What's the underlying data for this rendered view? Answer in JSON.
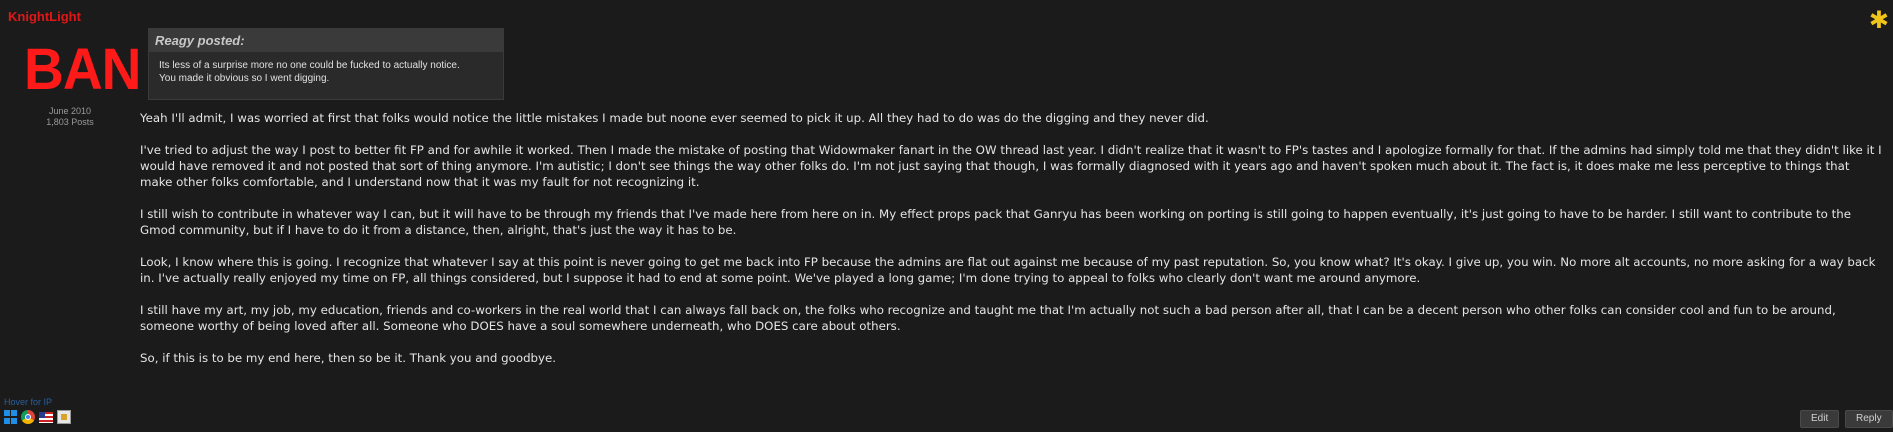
{
  "user": {
    "name": "KnightLight",
    "ban_text": "BAN",
    "join_date": "June 2010",
    "post_count": "1,803 Posts"
  },
  "quote": {
    "header": "Reagy posted:",
    "line1": "Its less of a surprise more no one could be fucked to actually notice.",
    "line2": "You made it obvious so I went digging."
  },
  "post": {
    "paragraphs": [
      "Yeah I'll admit, I was worried at first that folks would notice the little mistakes I made but noone ever seemed to pick it up. All they had to do was do the digging and they never did.",
      "I've tried to adjust the way I post to better fit FP and for awhile it worked. Then I made the mistake of posting that Widowmaker fanart in the OW thread last year. I didn't realize that it wasn't to FP's tastes and I apologize formally for that. If the admins had simply told me that they didn't like it I would have removed it and not posted that sort of thing anymore. I'm autistic; I don't see things the way other folks do. I'm not just saying that though, I was formally diagnosed with it years ago and haven't spoken much about it. The fact is, it does make me less perceptive to things that make other folks comfortable, and I understand now that it was my fault for not recognizing it.",
      "I still wish to contribute in whatever way I can, but it will have to be through my friends that I've made here from here on in. My effect props pack that Ganryu has been working on porting is still going to happen eventually, it's just going to have to be harder. I still want to contribute to the Gmod community, but if I have to do it from a distance, then, alright, that's just the way it has to be.",
      "Look, I know where this is going. I recognize that whatever I say at this point is never going to get me back into FP because the admins are flat out against me because of my past reputation. So, you know what? It's okay. I give up, you win. No more alt accounts, no more asking for a way back in. I've actually really enjoyed my time on FP, all things considered, but I suppose it had to end at some point. We've played a long game; I'm done trying to appeal to folks who clearly don't want me around anymore.",
      "I still have my art, my job, my education, friends and co-workers in the real world that I can always fall back on, the folks who recognize and taught me that I'm actually not such a bad person after all, that I can be a decent person who other folks can consider cool and fun to be around, someone worthy of being loved after all. Someone who DOES have a soul somewhere underneath, who DOES care about others.",
      "So, if this is to be my end here, then so be it. Thank you and goodbye."
    ]
  },
  "footer": {
    "hover_ip": "Hover for IP",
    "edit_label": "Edit",
    "reply_label": "Reply"
  },
  "icons": {
    "corner": "asterisk-icon",
    "os": "windows-icon",
    "browser": "chrome-icon",
    "flag": "us-flag-icon",
    "extra": "flag-icon"
  },
  "colors": {
    "background": "#1b1b1b",
    "username": "#e11717",
    "ban": "#ff1a1a",
    "star": "#f0c419"
  }
}
